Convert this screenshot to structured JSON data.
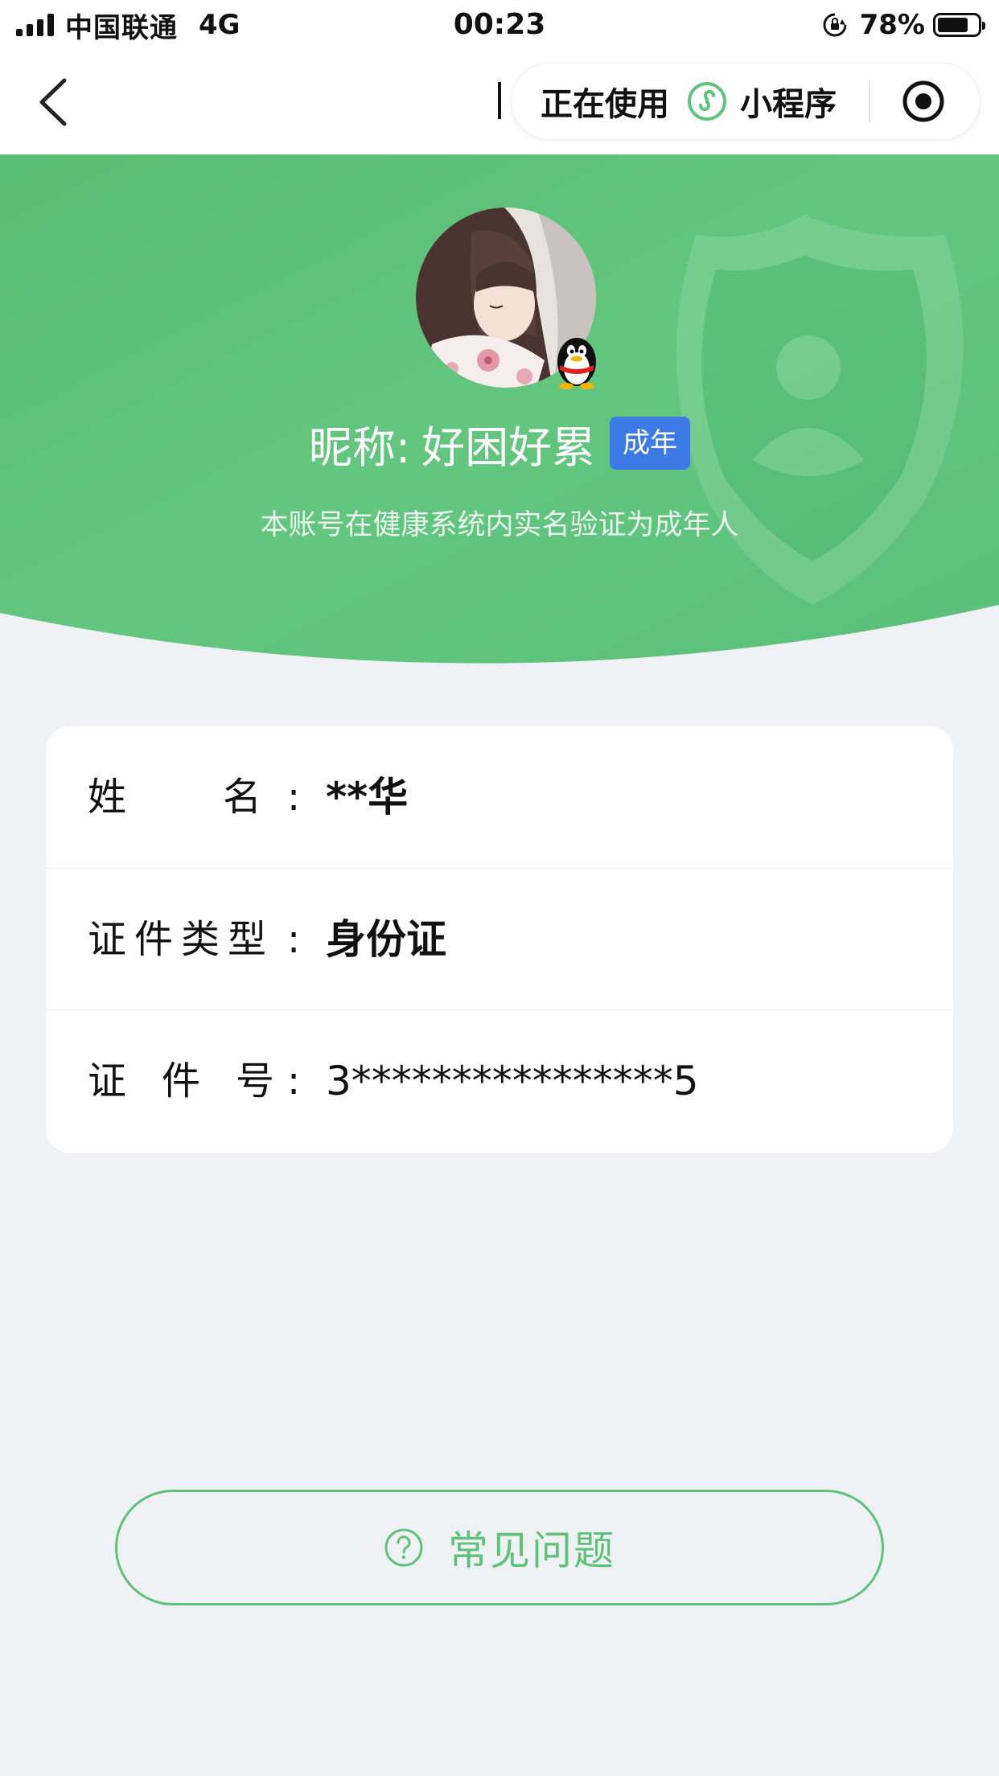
{
  "status_bar": {
    "carrier": "中国联通",
    "network": "4G",
    "time": "00:23",
    "battery_percent": "78%",
    "battery_level": 0.78,
    "icons": [
      "signal-icon",
      "rotation-lock-icon",
      "battery-icon"
    ]
  },
  "nav": {
    "back_icon": "chevron-left-icon",
    "capsule_status": "正在使用",
    "capsule_app": "小程序",
    "capsule_icon": "mini-program-icon",
    "close_icon": "record-circle-icon"
  },
  "profile": {
    "nickname_label": "昵称:",
    "nickname": "好困好累",
    "age_tag": "成年",
    "verify_text": "本账号在健康系统内实名验证为成年人",
    "avatar_badge_icon": "qq-penguin-icon"
  },
  "info": {
    "rows": [
      {
        "label": "姓名",
        "value": "**华"
      },
      {
        "label": "证件类型",
        "value": "身份证"
      },
      {
        "label": "证件号",
        "value": "3****************5"
      }
    ],
    "colon": ":"
  },
  "faq": {
    "label": "常见问题",
    "icon": "question-circle-icon"
  },
  "colors": {
    "header_green": "#5dc27a",
    "accent_green": "#5ec37a",
    "tag_blue": "#3c7be5",
    "page_bg": "#eff1f4"
  }
}
